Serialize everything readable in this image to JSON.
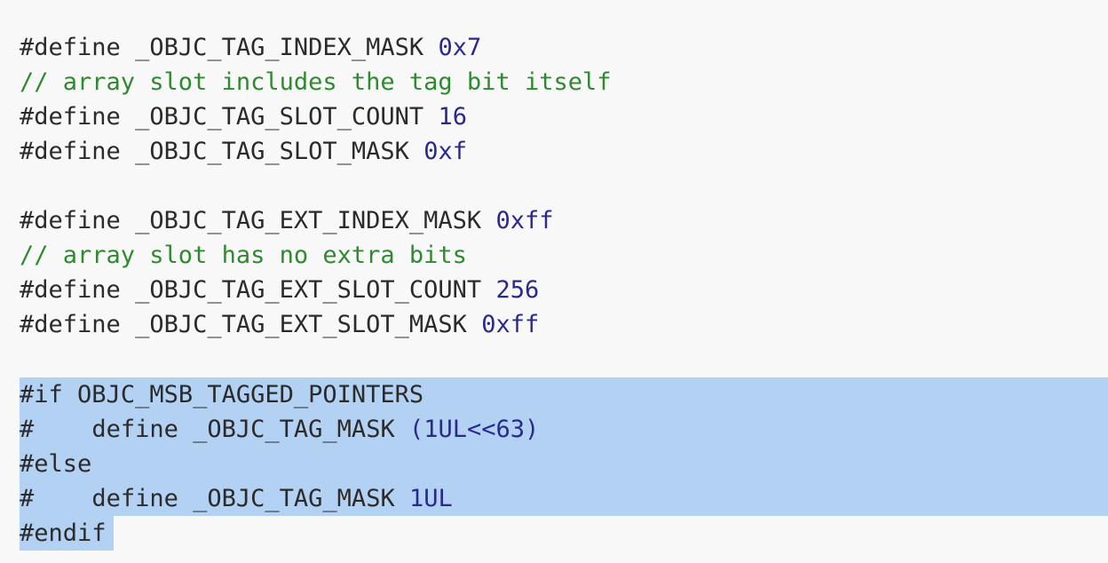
{
  "editor": {
    "lines": {
      "l1": {
        "directive": "#define",
        "name": "_OBJC_TAG_INDEX_MASK",
        "value": "0x7"
      },
      "l2": {
        "comment": "// array slot includes the tag bit itself"
      },
      "l3": {
        "directive": "#define",
        "name": "_OBJC_TAG_SLOT_COUNT",
        "value": "16"
      },
      "l4": {
        "directive": "#define",
        "name": "_OBJC_TAG_SLOT_MASK",
        "value": "0xf"
      },
      "l6": {
        "directive": "#define",
        "name": "_OBJC_TAG_EXT_INDEX_MASK",
        "value": "0xff"
      },
      "l7": {
        "comment": "// array slot has no extra bits"
      },
      "l8": {
        "directive": "#define",
        "name": "_OBJC_TAG_EXT_SLOT_COUNT",
        "value": "256"
      },
      "l9": {
        "directive": "#define",
        "name": "_OBJC_TAG_EXT_SLOT_MASK",
        "value": "0xff"
      },
      "l11": {
        "directive": "#if",
        "name": "OBJC_MSB_TAGGED_POINTERS"
      },
      "l12": {
        "directive": "#",
        "indent": "   ",
        "keyword": "define",
        "name": "_OBJC_TAG_MASK",
        "value": "(1UL<<63)"
      },
      "l13": {
        "directive": "#else"
      },
      "l14": {
        "directive": "#",
        "indent": "   ",
        "keyword": "define",
        "name": "_OBJC_TAG_MASK",
        "value": "1UL"
      },
      "l15": {
        "directive": "#endif"
      }
    }
  }
}
